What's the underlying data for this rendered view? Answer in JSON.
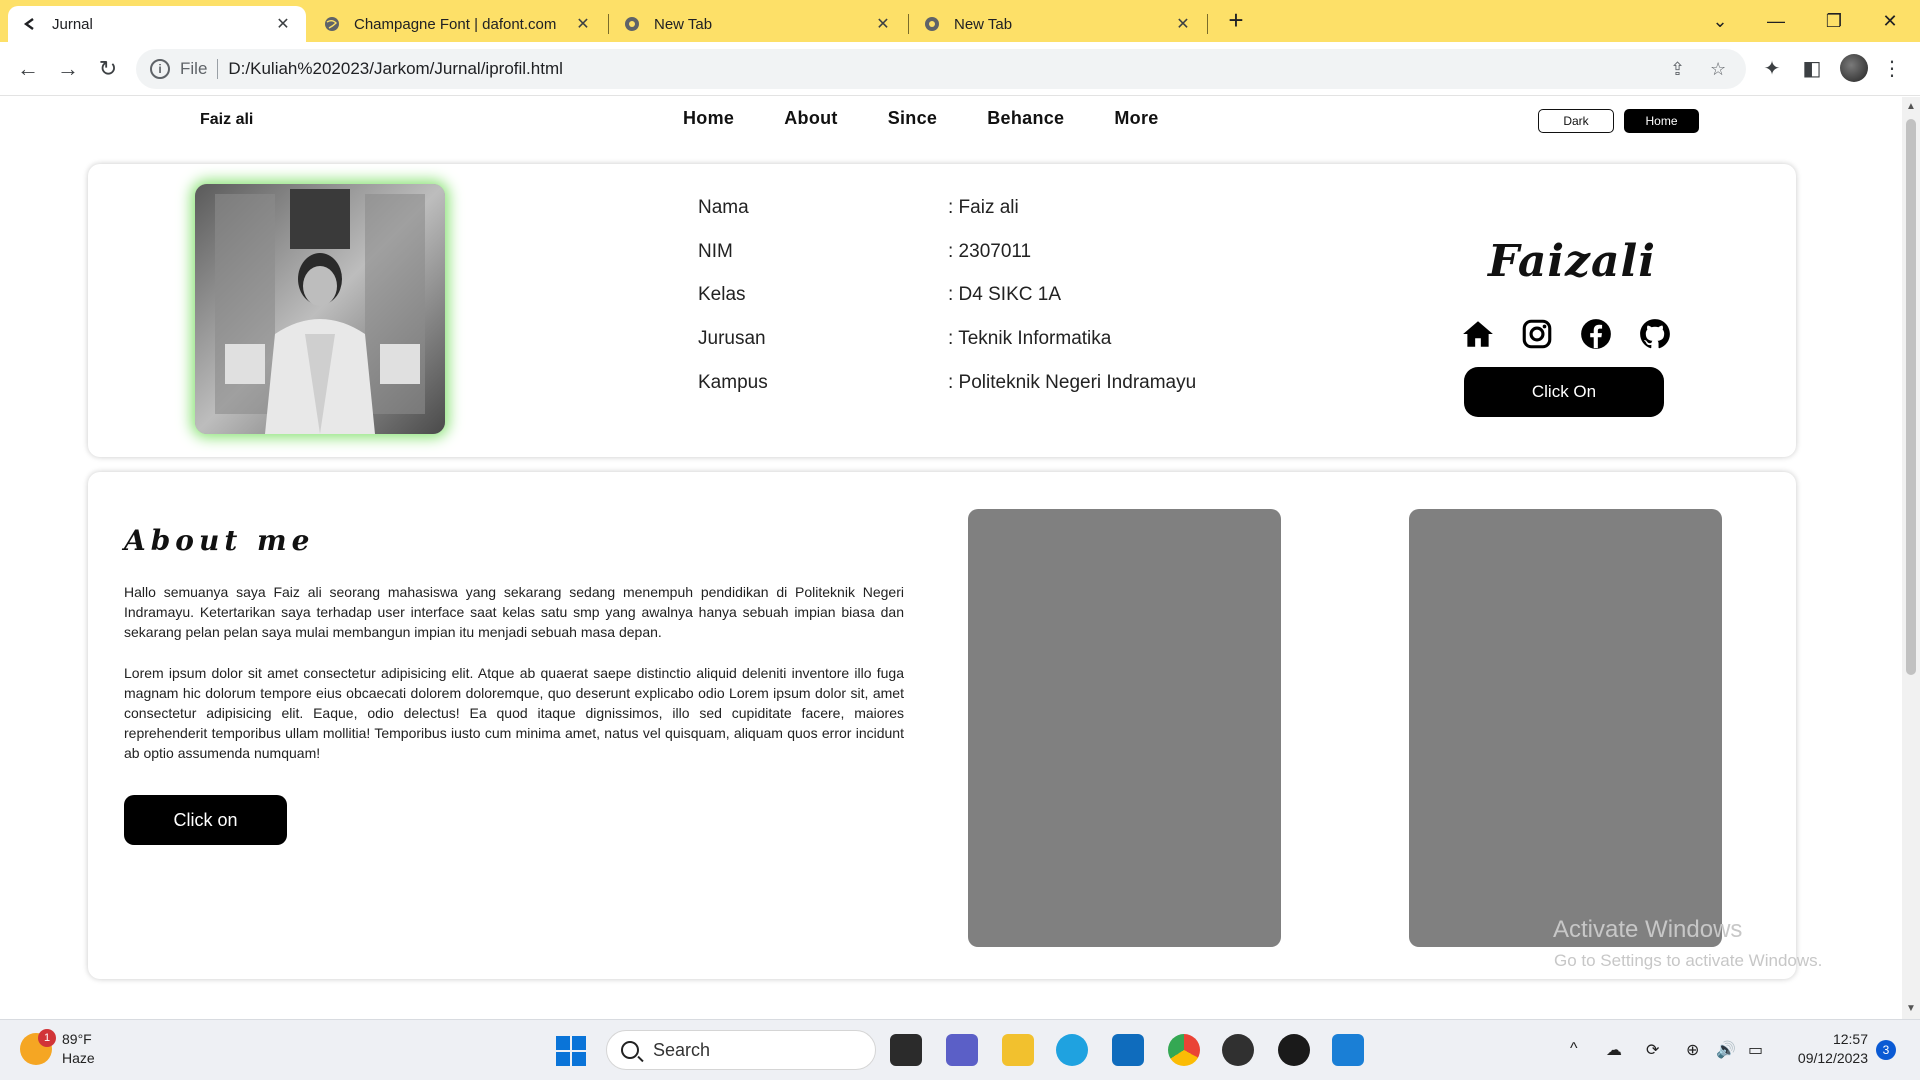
{
  "browser": {
    "tabs": [
      {
        "title": "Jurnal",
        "active": true
      },
      {
        "title": "Champagne Font | dafont.com",
        "active": false
      },
      {
        "title": "New Tab",
        "active": false
      },
      {
        "title": "New Tab",
        "active": false
      }
    ],
    "new_tab_label": "+",
    "address": {
      "scheme_label": "File",
      "url": "D:/Kuliah%202023/Jarkom/Jurnal/iprofil.html"
    }
  },
  "site": {
    "brand": "Faiz ali",
    "menu": [
      "Home",
      "About",
      "Since",
      "Behance",
      "More"
    ],
    "dark_button": "Dark",
    "home_button": "Home"
  },
  "profile": {
    "rows": [
      {
        "label": "Nama",
        "value": ": Faiz ali"
      },
      {
        "label": "NIM",
        "value": ": 2307011"
      },
      {
        "label": "Kelas",
        "value": ": D4 SIKC 1A"
      },
      {
        "label": "Jurusan",
        "value": ": Teknik Informatika"
      },
      {
        "label": "Kampus",
        "value": ": Politeknik Negeri Indramayu"
      }
    ],
    "signature": "Faizali",
    "social_icons": [
      "home-icon",
      "instagram-icon",
      "facebook-icon",
      "github-icon"
    ],
    "click_button": "Click On",
    "photo_glow_color": "#8ee37a"
  },
  "about": {
    "title": "About me",
    "paragraph1": "Hallo semuanya saya Faiz ali seorang mahasiswa yang sekarang sedang menempuh pendidikan di Politeknik Negeri Indramayu. Ketertarikan saya terhadap user interface saat kelas satu smp yang awalnya hanya sebuah impian biasa dan sekarang pelan pelan saya mulai membangun impian itu menjadi sebuah masa depan.",
    "paragraph2": "Lorem ipsum dolor sit amet consectetur adipisicing elit. Atque ab quaerat saepe distinctio aliquid deleniti inventore illo fuga magnam hic dolorum tempore eius obcaecati dolorem doloremque, quo deserunt explicabo odio Lorem ipsum dolor sit, amet consectetur adipisicing elit. Eaque, odio delectus! Ea quod itaque dignissimos, illo sed cupiditate facere, maiores reprehenderit temporibus ullam mollitia! Temporibus iusto cum minima amet, natus vel quisquam, aliquam quos error incidunt ab optio assumenda numquam!",
    "click_button": "Click on",
    "panel_color": "#808080"
  },
  "watermark": {
    "title": "Activate Windows",
    "subtitle": "Go to Settings to activate Windows."
  },
  "taskbar": {
    "weather_temp": "89°F",
    "weather_desc": "Haze",
    "weather_badge": "1",
    "search_label": "Search",
    "time": "12:57",
    "date": "09/12/2023",
    "notification_count": "3"
  }
}
